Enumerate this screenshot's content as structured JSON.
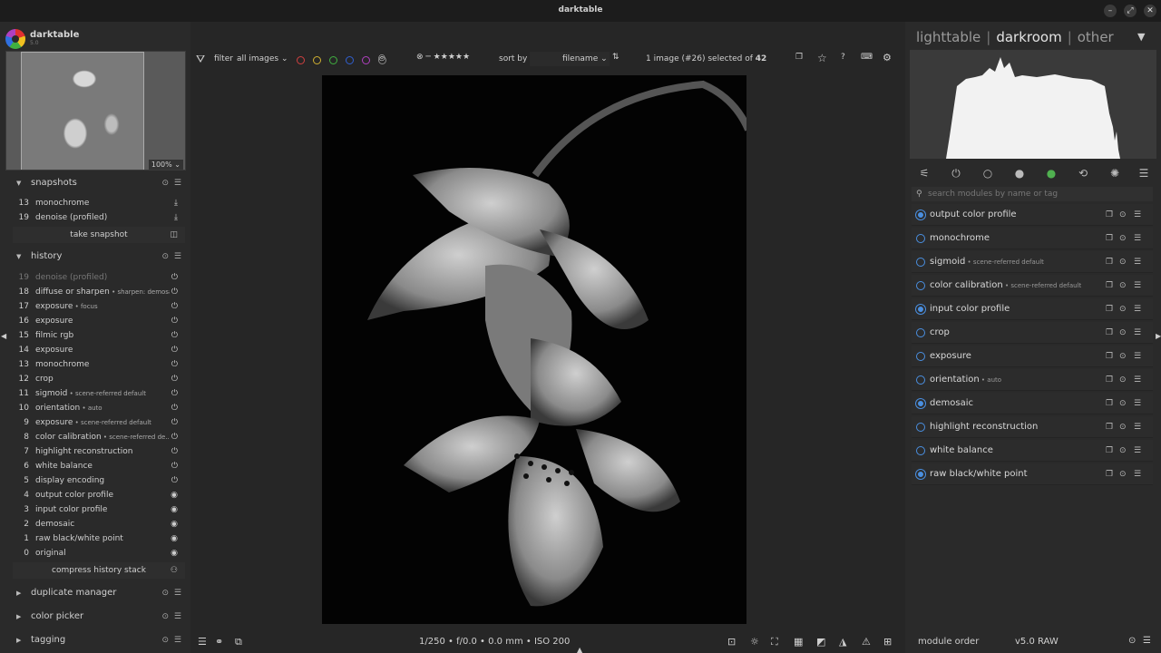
{
  "window": {
    "title": "darktable"
  },
  "brand": {
    "name": "darktable",
    "version": "5.0"
  },
  "navigation": {
    "zoom": "100%"
  },
  "snapshots": {
    "title": "snapshots",
    "items": [
      {
        "num": "13",
        "label": "monochrome"
      },
      {
        "num": "19",
        "label": "denoise (profiled)"
      }
    ],
    "take_label": "take snapshot"
  },
  "history": {
    "title": "history",
    "items": [
      {
        "num": "19",
        "label": "denoise (profiled)",
        "sub": ""
      },
      {
        "num": "18",
        "label": "diffuse or sharpen",
        "sub": "sharpen: demosaic"
      },
      {
        "num": "17",
        "label": "exposure",
        "sub": "focus"
      },
      {
        "num": "16",
        "label": "exposure",
        "sub": ""
      },
      {
        "num": "15",
        "label": "filmic rgb",
        "sub": ""
      },
      {
        "num": "14",
        "label": "exposure",
        "sub": ""
      },
      {
        "num": "13",
        "label": "monochrome",
        "sub": ""
      },
      {
        "num": "12",
        "label": "crop",
        "sub": ""
      },
      {
        "num": "11",
        "label": "sigmoid",
        "sub": "scene-referred default"
      },
      {
        "num": "10",
        "label": "orientation",
        "sub": "auto"
      },
      {
        "num": "9",
        "label": "exposure",
        "sub": "scene-referred default"
      },
      {
        "num": "8",
        "label": "color calibration",
        "sub": "scene-referred de..."
      },
      {
        "num": "7",
        "label": "highlight reconstruction",
        "sub": ""
      },
      {
        "num": "6",
        "label": "white balance",
        "sub": ""
      },
      {
        "num": "5",
        "label": "display encoding",
        "sub": ""
      },
      {
        "num": "4",
        "label": "output color profile",
        "sub": ""
      },
      {
        "num": "3",
        "label": "input color profile",
        "sub": ""
      },
      {
        "num": "2",
        "label": "demosaic",
        "sub": ""
      },
      {
        "num": "1",
        "label": "raw black/white point",
        "sub": ""
      },
      {
        "num": "0",
        "label": "original",
        "sub": ""
      }
    ],
    "compress_label": "compress history stack"
  },
  "left_modules": [
    {
      "title": "duplicate manager"
    },
    {
      "title": "color picker"
    },
    {
      "title": "tagging"
    }
  ],
  "filterbar": {
    "filter_label": "filter",
    "filter_value": "all images",
    "sort_label": "sort by",
    "sort_value": "filename",
    "selection_prefix": "1 image (#26) selected of ",
    "selection_total": "42",
    "color_labels": [
      "#d04040",
      "#d0b030",
      "#40b040",
      "#3060d0",
      "#b040c0"
    ]
  },
  "image_info": "1/250 • f/0.0 • 0.0 mm • ISO 200",
  "views": {
    "lighttable": "lighttable",
    "darkroom": "darkroom",
    "other": "other"
  },
  "search": {
    "placeholder": "search modules by name or tag"
  },
  "modules": [
    {
      "name": "output color profile",
      "sub": "",
      "on": true
    },
    {
      "name": "monochrome",
      "sub": "",
      "on": false
    },
    {
      "name": "sigmoid",
      "sub": "scene-referred default",
      "on": false
    },
    {
      "name": "color calibration",
      "sub": "scene-referred default",
      "on": false
    },
    {
      "name": "input color profile",
      "sub": "",
      "on": true
    },
    {
      "name": "crop",
      "sub": "",
      "on": false
    },
    {
      "name": "exposure",
      "sub": "",
      "on": false
    },
    {
      "name": "orientation",
      "sub": "auto",
      "on": false
    },
    {
      "name": "demosaic",
      "sub": "",
      "on": true
    },
    {
      "name": "highlight reconstruction",
      "sub": "",
      "on": false
    },
    {
      "name": "white balance",
      "sub": "",
      "on": false
    },
    {
      "name": "raw black/white point",
      "sub": "",
      "on": true
    }
  ],
  "footer": {
    "module_order_label": "module order",
    "module_order_value": "v5.0 RAW"
  },
  "accent": "#4a8fe0"
}
